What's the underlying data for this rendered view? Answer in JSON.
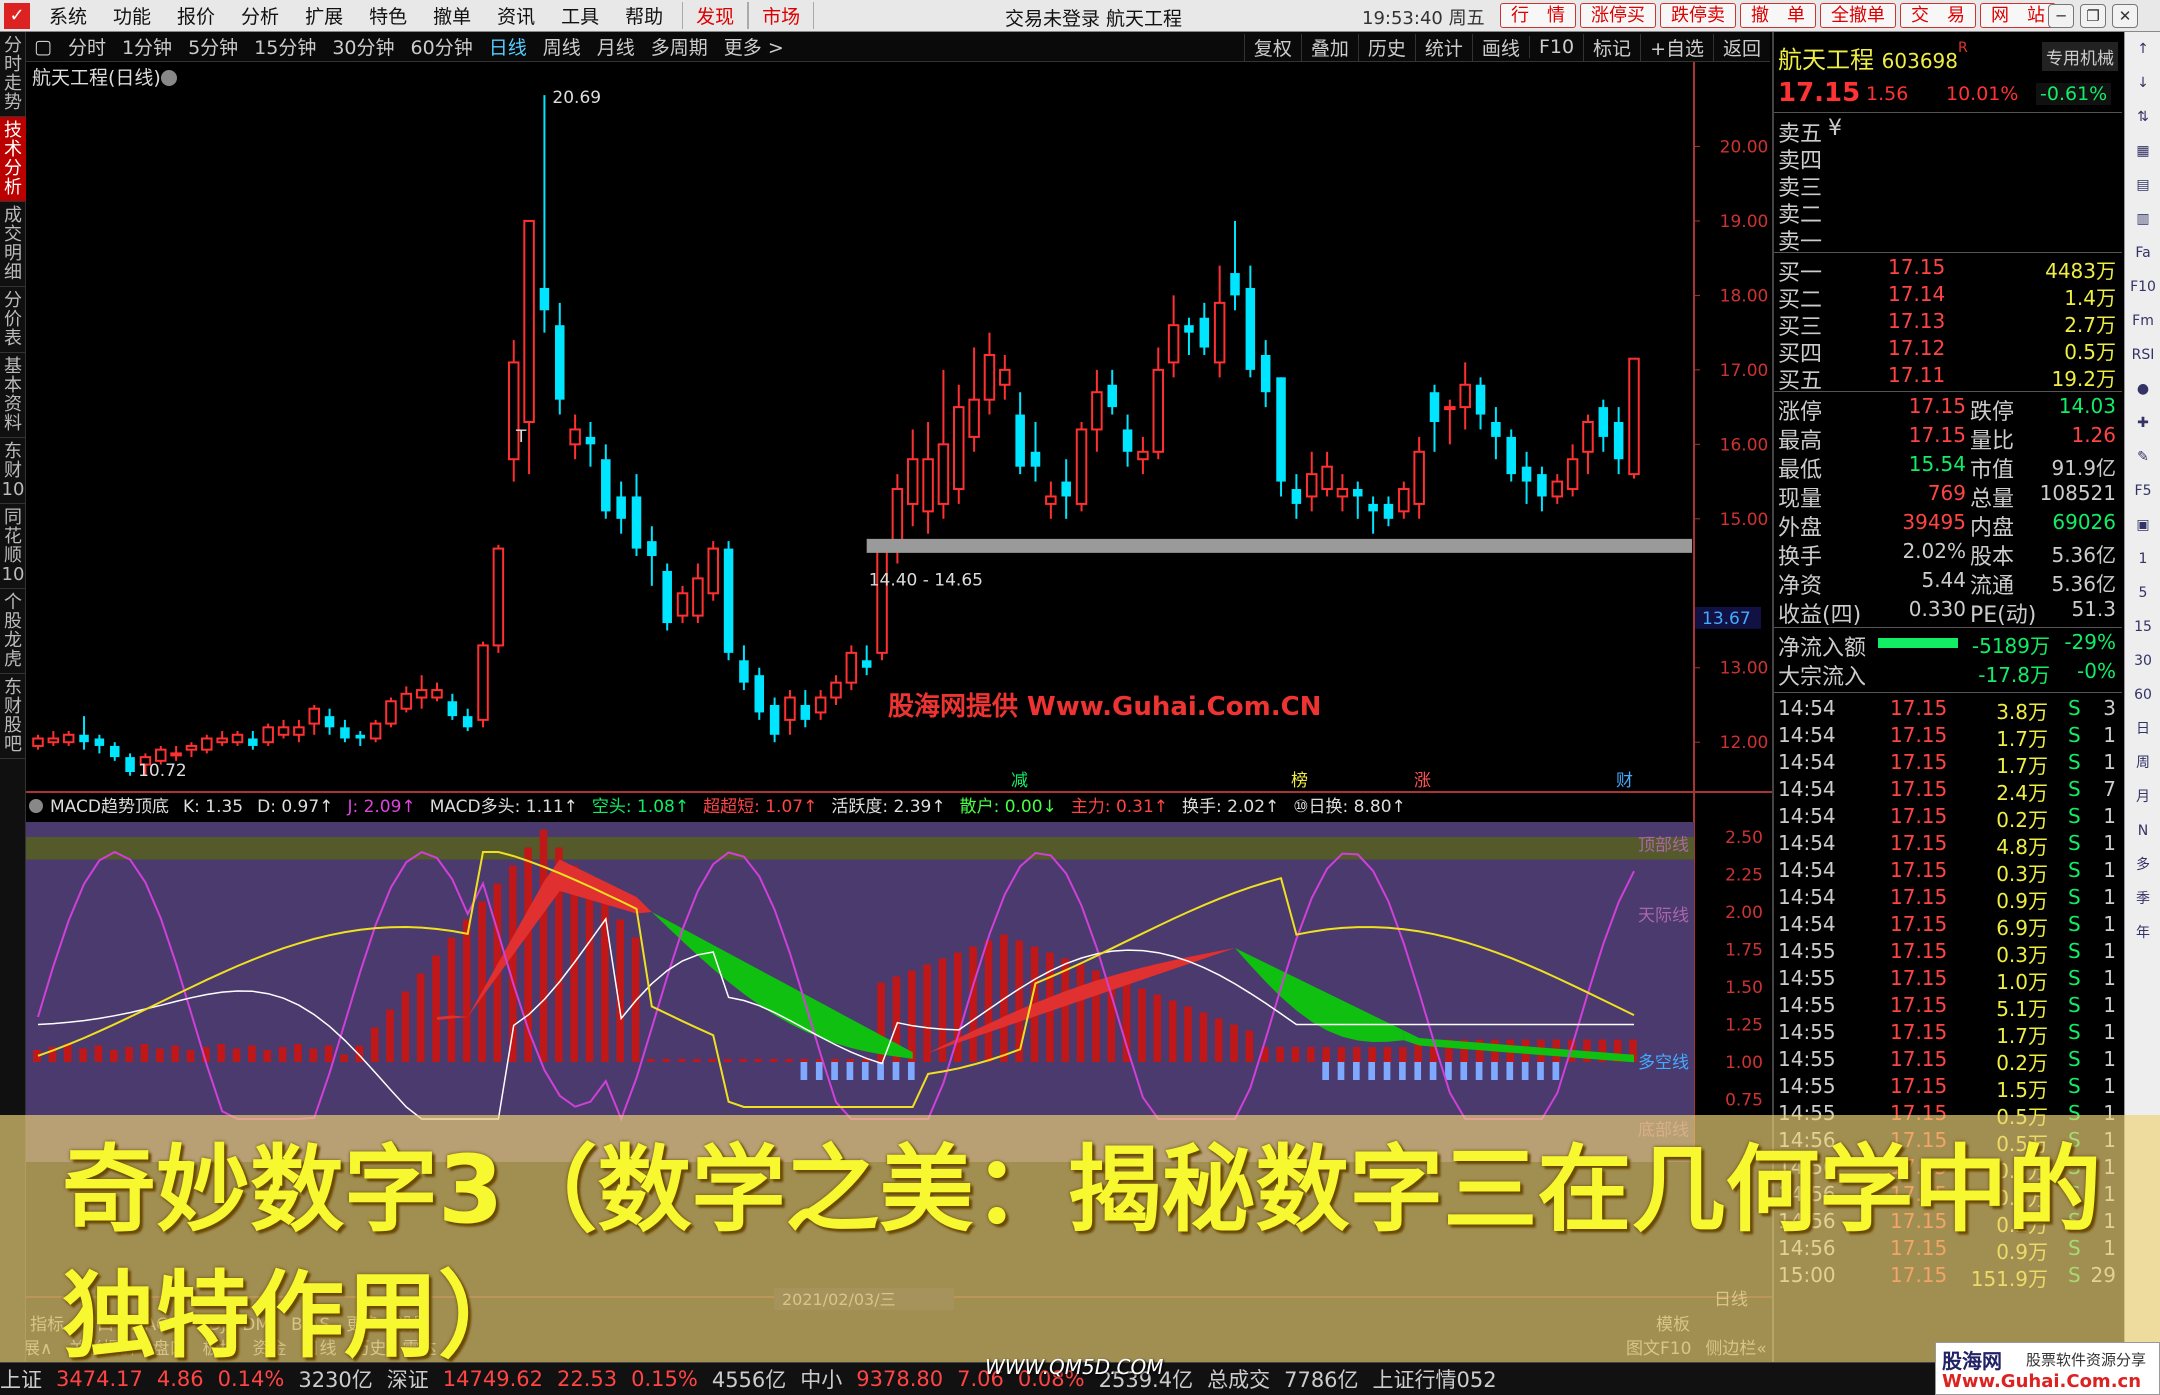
{
  "menu": {
    "items": [
      "系统",
      "功能",
      "报价",
      "分析",
      "扩展",
      "特色",
      "撤单",
      "资讯",
      "工具",
      "帮助"
    ],
    "red_items": [
      "发现",
      "市场"
    ]
  },
  "window_title": "交易未登录  航天工程",
  "clock": "19:53:40 周五",
  "top_buttons": [
    "行　情",
    "涨停买",
    "跌停卖",
    "撤　单",
    "全撤单",
    "交　易",
    "网　站"
  ],
  "left_tabs": [
    "分时走势",
    "技术分析",
    "成交明细",
    "分价表",
    "基本资料",
    "东财10",
    "同花顺10",
    "个股龙虎",
    "东财股吧"
  ],
  "toolbar": {
    "periods": [
      "分时",
      "1分钟",
      "5分钟",
      "15分钟",
      "30分钟",
      "60分钟",
      "日线",
      "周线",
      "月线",
      "多周期",
      "更多 >"
    ],
    "active": "日线",
    "right": [
      "复权",
      "叠加",
      "历史",
      "统计",
      "画线",
      "F10",
      "标记",
      "+自选",
      "返回"
    ]
  },
  "chart_title": "航天工程(日线)",
  "panel": {
    "name": "航天工程",
    "code": "603698",
    "code_sup": "R",
    "special": "专用机械",
    "price": "17.15",
    "change": "1.56",
    "pct": "10.01%",
    "other": "-0.61%",
    "sell": [
      {
        "label": "卖五",
        "note": "¥"
      },
      {
        "label": "卖四"
      },
      {
        "label": "卖三"
      },
      {
        "label": "卖二"
      },
      {
        "label": "卖一"
      }
    ],
    "buy": [
      {
        "label": "买一",
        "price": "17.15",
        "vol": "4483万"
      },
      {
        "label": "买二",
        "price": "17.14",
        "vol": "1.4万"
      },
      {
        "label": "买三",
        "price": "17.13",
        "vol": "2.7万"
      },
      {
        "label": "买四",
        "price": "17.12",
        "vol": "0.5万"
      },
      {
        "label": "买五",
        "price": "17.11",
        "vol": "19.2万"
      }
    ],
    "stats": [
      {
        "l1": "涨停",
        "v1": "17.15",
        "l2": "跌停",
        "v2": "14.03"
      },
      {
        "l1": "最高",
        "v1": "17.15",
        "l2": "量比",
        "v2": "1.26"
      },
      {
        "l1": "最低",
        "v1": "15.54",
        "l2": "市值",
        "v2": "91.9亿"
      },
      {
        "l1": "现量",
        "v1": "769",
        "l2": "总量",
        "v2": "108521"
      },
      {
        "l1": "外盘",
        "v1": "39495",
        "l2": "内盘",
        "v2": "69026"
      },
      {
        "l1": "换手",
        "v1": "2.02%",
        "l2": "股本",
        "v2": "5.36亿"
      },
      {
        "l1": "净资",
        "v1": "5.44",
        "l2": "流通",
        "v2": "5.36亿"
      },
      {
        "l1": "收益(四)",
        "v1": "0.330",
        "l2": "PE(动)",
        "v2": "51.3"
      }
    ],
    "flow": [
      {
        "label": "净流入额",
        "value": "-5189万",
        "pct": "-29%"
      },
      {
        "label": "大宗流入",
        "value": "-17.8万",
        "pct": "-0%"
      }
    ],
    "ticks": [
      {
        "t": "14:54",
        "p": "17.15",
        "v": "3.8万",
        "s": "S",
        "n": "3"
      },
      {
        "t": "14:54",
        "p": "17.15",
        "v": "1.7万",
        "s": "S",
        "n": "1"
      },
      {
        "t": "14:54",
        "p": "17.15",
        "v": "1.7万",
        "s": "S",
        "n": "1"
      },
      {
        "t": "14:54",
        "p": "17.15",
        "v": "2.4万",
        "s": "S",
        "n": "7"
      },
      {
        "t": "14:54",
        "p": "17.15",
        "v": "0.2万",
        "s": "S",
        "n": "1"
      },
      {
        "t": "14:54",
        "p": "17.15",
        "v": "4.8万",
        "s": "S",
        "n": "1"
      },
      {
        "t": "14:54",
        "p": "17.15",
        "v": "0.3万",
        "s": "S",
        "n": "1"
      },
      {
        "t": "14:54",
        "p": "17.15",
        "v": "0.9万",
        "s": "S",
        "n": "1"
      },
      {
        "t": "14:54",
        "p": "17.15",
        "v": "6.9万",
        "s": "S",
        "n": "1"
      },
      {
        "t": "14:55",
        "p": "17.15",
        "v": "0.3万",
        "s": "S",
        "n": "1"
      },
      {
        "t": "14:55",
        "p": "17.15",
        "v": "1.0万",
        "s": "S",
        "n": "1"
      },
      {
        "t": "14:55",
        "p": "17.15",
        "v": "5.1万",
        "s": "S",
        "n": "1"
      },
      {
        "t": "14:55",
        "p": "17.15",
        "v": "1.7万",
        "s": "S",
        "n": "1"
      },
      {
        "t": "14:55",
        "p": "17.15",
        "v": "0.2万",
        "s": "S",
        "n": "1"
      },
      {
        "t": "14:55",
        "p": "17.15",
        "v": "1.5万",
        "s": "S",
        "n": "1"
      },
      {
        "t": "14:55",
        "p": "17.15",
        "v": "0.5万",
        "s": "S",
        "n": "1"
      },
      {
        "t": "14:56",
        "p": "17.15",
        "v": "0.5万",
        "s": "S",
        "n": "1"
      },
      {
        "t": "14:56",
        "p": "17.15",
        "v": "0.3万",
        "s": "S",
        "n": "1"
      },
      {
        "t": "14:56",
        "p": "17.15",
        "v": "0.9万",
        "s": "S",
        "n": "1"
      },
      {
        "t": "14:56",
        "p": "17.15",
        "v": "0.2万",
        "s": "S",
        "n": "1"
      },
      {
        "t": "14:56",
        "p": "17.15",
        "v": "0.9万",
        "s": "S",
        "n": "1"
      },
      {
        "t": "15:00",
        "p": "17.15",
        "v": "151.9万",
        "s": "S",
        "n": "29"
      }
    ]
  },
  "right_icons": [
    "↑",
    "↓",
    "⇅",
    "▦",
    "▤",
    "▥",
    "Fa",
    "F10",
    "Fm",
    "RSI",
    "●",
    "✚",
    "✎",
    "F5",
    "▣",
    "1",
    "5",
    "15",
    "30",
    "60",
    "日",
    "周",
    "月",
    "N",
    "多",
    "季",
    "年"
  ],
  "indicator_header": [
    "MACD趋势顶底",
    "K: 1.35",
    "D: 0.97↑",
    "J: 2.09↑",
    "MACD多头: 1.11↑",
    "空头: 1.08↑",
    "超超短: 1.07↑",
    "活跃度: 2.39↑",
    "散户: 0.00↓",
    "主力: 0.31↑",
    "换手: 2.02↑",
    "⑩日换: 8.80↑"
  ],
  "chart_data": {
    "type": "candlestick",
    "title": "航天工程(日线)",
    "ylim": [
      11.6,
      21.0
    ],
    "y_ticks": [
      "20.00",
      "19.00",
      "18.00",
      "17.00",
      "16.00",
      "15.00",
      "13.00",
      "12.00"
    ],
    "candles": [
      [
        11.95,
        12.05,
        11.9,
        12.1
      ],
      [
        12.0,
        12.05,
        11.95,
        12.15
      ],
      [
        12.0,
        12.1,
        11.95,
        12.15
      ],
      [
        12.1,
        12.0,
        11.9,
        12.35
      ],
      [
        12.05,
        11.95,
        11.85,
        12.1
      ],
      [
        11.95,
        11.8,
        11.75,
        12.0
      ],
      [
        11.8,
        11.6,
        11.55,
        11.85
      ],
      [
        11.7,
        11.8,
        11.55,
        11.85
      ],
      [
        11.75,
        11.9,
        11.7,
        11.95
      ],
      [
        11.85,
        11.85,
        11.75,
        11.95
      ],
      [
        11.9,
        11.95,
        11.8,
        12.0
      ],
      [
        11.9,
        12.05,
        11.85,
        12.1
      ],
      [
        12.0,
        12.05,
        11.95,
        12.15
      ],
      [
        12.0,
        12.1,
        11.95,
        12.15
      ],
      [
        12.05,
        11.95,
        11.9,
        12.15
      ],
      [
        12.0,
        12.2,
        11.95,
        12.25
      ],
      [
        12.1,
        12.2,
        12.05,
        12.3
      ],
      [
        12.1,
        12.2,
        12.0,
        12.3
      ],
      [
        12.25,
        12.45,
        12.1,
        12.5
      ],
      [
        12.35,
        12.2,
        12.1,
        12.45
      ],
      [
        12.2,
        12.05,
        12.0,
        12.3
      ],
      [
        12.1,
        12.05,
        11.95,
        12.15
      ],
      [
        12.05,
        12.25,
        12.0,
        12.3
      ],
      [
        12.25,
        12.55,
        12.2,
        12.6
      ],
      [
        12.45,
        12.65,
        12.4,
        12.75
      ],
      [
        12.6,
        12.7,
        12.45,
        12.9
      ],
      [
        12.6,
        12.7,
        12.55,
        12.8
      ],
      [
        12.55,
        12.35,
        12.3,
        12.65
      ],
      [
        12.35,
        12.2,
        12.15,
        12.45
      ],
      [
        12.3,
        13.3,
        12.2,
        13.35
      ],
      [
        13.3,
        14.6,
        13.2,
        14.65
      ],
      [
        15.8,
        17.1,
        15.5,
        17.4
      ],
      [
        16.3,
        19.0,
        15.6,
        19.0
      ],
      [
        18.1,
        17.8,
        17.5,
        20.69
      ],
      [
        17.6,
        16.6,
        16.4,
        17.9
      ],
      [
        16.0,
        16.2,
        15.8,
        16.4
      ],
      [
        16.1,
        16.0,
        15.7,
        16.3
      ],
      [
        15.8,
        15.1,
        15.0,
        16.0
      ],
      [
        15.3,
        15.0,
        14.8,
        15.5
      ],
      [
        15.3,
        14.6,
        14.5,
        15.6
      ],
      [
        14.7,
        14.5,
        14.1,
        14.9
      ],
      [
        14.3,
        13.6,
        13.5,
        14.4
      ],
      [
        13.7,
        14.0,
        13.6,
        14.1
      ],
      [
        13.7,
        14.2,
        13.6,
        14.4
      ],
      [
        14.0,
        14.6,
        13.9,
        14.7
      ],
      [
        14.6,
        13.2,
        13.1,
        14.7
      ],
      [
        13.1,
        12.8,
        12.7,
        13.3
      ],
      [
        12.9,
        12.4,
        12.3,
        13.0
      ],
      [
        12.5,
        12.1,
        12.0,
        12.6
      ],
      [
        12.3,
        12.6,
        12.1,
        12.7
      ],
      [
        12.5,
        12.3,
        12.2,
        12.7
      ],
      [
        12.4,
        12.6,
        12.3,
        12.7
      ],
      [
        12.6,
        12.8,
        12.5,
        12.9
      ],
      [
        12.8,
        13.2,
        12.7,
        13.3
      ],
      [
        13.1,
        13.0,
        12.9,
        13.3
      ],
      [
        13.2,
        14.6,
        13.1,
        14.6
      ],
      [
        14.6,
        15.4,
        14.4,
        15.6
      ],
      [
        15.2,
        15.8,
        14.9,
        16.2
      ],
      [
        15.1,
        15.8,
        14.8,
        16.3
      ],
      [
        15.2,
        16.0,
        15.0,
        17.0
      ],
      [
        15.4,
        16.5,
        15.2,
        16.8
      ],
      [
        16.1,
        16.6,
        15.9,
        17.3
      ],
      [
        16.6,
        17.2,
        16.4,
        17.5
      ],
      [
        16.8,
        17.0,
        16.6,
        17.2
      ],
      [
        16.4,
        15.7,
        15.6,
        16.7
      ],
      [
        15.9,
        15.7,
        15.5,
        16.3
      ],
      [
        15.2,
        15.3,
        15.0,
        15.5
      ],
      [
        15.5,
        15.3,
        15.0,
        15.8
      ],
      [
        15.2,
        16.2,
        15.1,
        16.3
      ],
      [
        16.2,
        16.7,
        15.9,
        17.0
      ],
      [
        16.8,
        16.5,
        16.4,
        17.0
      ],
      [
        16.2,
        15.9,
        15.7,
        16.4
      ],
      [
        15.8,
        15.9,
        15.6,
        16.1
      ],
      [
        15.9,
        17.0,
        15.8,
        17.3
      ],
      [
        17.1,
        17.6,
        16.9,
        18.0
      ],
      [
        17.6,
        17.5,
        17.2,
        17.7
      ],
      [
        17.7,
        17.3,
        17.2,
        17.9
      ],
      [
        17.1,
        17.9,
        16.9,
        18.4
      ],
      [
        18.3,
        18.0,
        17.8,
        19.0
      ],
      [
        18.1,
        17.0,
        16.9,
        18.4
      ],
      [
        17.2,
        16.7,
        16.5,
        17.4
      ],
      [
        16.9,
        15.5,
        15.3,
        16.9
      ],
      [
        15.4,
        15.2,
        15.0,
        15.6
      ],
      [
        15.3,
        15.6,
        15.1,
        15.9
      ],
      [
        15.4,
        15.7,
        15.3,
        15.9
      ],
      [
        15.3,
        15.4,
        15.1,
        15.6
      ],
      [
        15.4,
        15.3,
        15.0,
        15.5
      ],
      [
        15.2,
        15.1,
        14.8,
        15.3
      ],
      [
        15.2,
        15.0,
        14.9,
        15.3
      ],
      [
        15.1,
        15.4,
        15.0,
        15.5
      ],
      [
        15.2,
        15.9,
        15.0,
        16.1
      ],
      [
        16.7,
        16.3,
        15.9,
        16.8
      ],
      [
        16.5,
        16.5,
        16.0,
        16.6
      ],
      [
        16.5,
        16.8,
        16.2,
        17.1
      ],
      [
        16.8,
        16.4,
        16.2,
        16.9
      ],
      [
        16.3,
        16.1,
        15.8,
        16.5
      ],
      [
        16.1,
        15.6,
        15.5,
        16.2
      ],
      [
        15.7,
        15.5,
        15.2,
        15.9
      ],
      [
        15.6,
        15.3,
        15.1,
        15.7
      ],
      [
        15.3,
        15.5,
        15.2,
        15.6
      ],
      [
        15.4,
        15.8,
        15.3,
        16.0
      ],
      [
        15.9,
        16.3,
        15.6,
        16.4
      ],
      [
        16.5,
        16.1,
        15.9,
        16.6
      ],
      [
        16.3,
        15.8,
        15.6,
        16.5
      ],
      [
        15.6,
        17.15,
        15.54,
        17.15
      ]
    ],
    "support_band": {
      "label": "14.40 - 14.65",
      "low": 14.4,
      "high": 14.65
    },
    "high_label": "20.69",
    "low_label": "10.72",
    "last_tag": "13.67",
    "markers": [
      "减",
      "榜",
      "涨",
      "财"
    ],
    "macd": {
      "ylim": [
        0.6,
        2.6
      ],
      "y_ticks": [
        "2.50",
        "2.25",
        "2.00",
        "1.75",
        "1.50",
        "1.25",
        "1.00",
        "0.75"
      ],
      "labels": [
        "顶部线",
        "天际线",
        "多空线",
        "底部线"
      ]
    },
    "axis": {
      "date": "2021/02/03/三",
      "period_label": "日线"
    }
  },
  "bottom_tabs": [
    "指标",
    "窗口",
    "MACD",
    "KDJ",
    "DMI",
    "BIAS",
    "更多",
    "设置"
  ],
  "expand": [
    "扩展∧",
    "关联报价",
    "盘口",
    "板块",
    "资金",
    "日线",
    "历史",
    "雷达"
  ],
  "bottom_right": [
    "图文F10",
    "侧边栏«",
    "笔",
    "价",
    "细",
    "势"
  ],
  "status": {
    "items": [
      "上证",
      "3474.17",
      "4.86",
      "0.14%",
      "3230亿",
      "深证",
      "14749.62",
      "22.53",
      "0.15%",
      "4556亿",
      "中小",
      "9378.80",
      "7.06",
      "0.08%",
      "2539.4亿",
      "总成交",
      "7786亿",
      "上证行情052"
    ]
  },
  "watermark": "股海网提供  Www.Guhai.Com.CN",
  "overlay_title": "奇妙数字3（数学之美：揭秘数字三在几何学中的独特作用）",
  "qm5d": "WWW.QM5D.COM",
  "guhai": {
    "a": "股海网",
    "b": "股票软件资源分享",
    "c": "Www.Guhai.Com.cn"
  },
  "colors": {
    "up": "#ff3030",
    "down": "#00e5ff",
    "band": "#9a9a9a",
    "macd_bg": "#4a3a6e",
    "fill_red": "#e03030",
    "fill_green": "#10c010"
  }
}
